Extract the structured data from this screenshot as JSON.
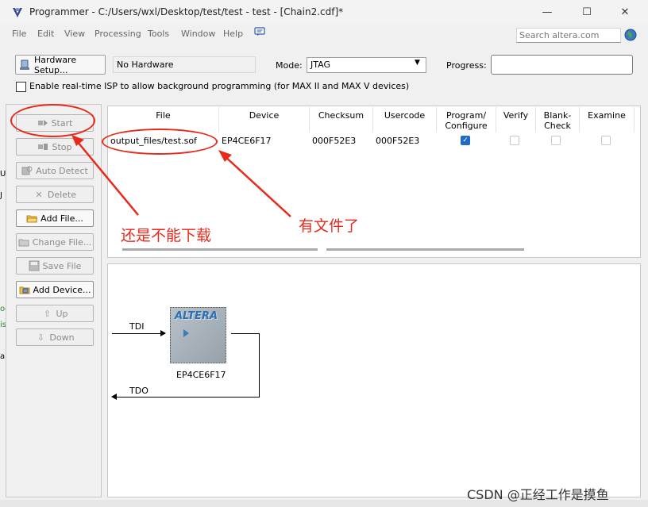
{
  "window": {
    "title": "Programmer - C:/Users/wxl/Desktop/test/test - test - [Chain2.cdf]*",
    "minimize": "—",
    "maximize": "☐",
    "close": "✕"
  },
  "menu": [
    "File",
    "Edit",
    "View",
    "Processing",
    "Tools",
    "Window",
    "Help"
  ],
  "search": {
    "placeholder": "Search altera.com"
  },
  "hardware": {
    "button_label": "Hardware Setup...",
    "current": "No Hardware",
    "mode_label": "Mode:",
    "mode_value": "JTAG",
    "progress_label": "Progress:"
  },
  "isp_option": "Enable real-time ISP to allow background programming (for MAX II and MAX V devices)",
  "actions": {
    "start": "Start",
    "stop": "Stop",
    "auto_detect": "Auto Detect",
    "delete": "Delete",
    "add_file": "Add File...",
    "change_file": "Change File...",
    "save_file": "Save File",
    "add_device": "Add Device...",
    "up": "Up",
    "down": "Down"
  },
  "table": {
    "headers": {
      "file": "File",
      "device": "Device",
      "checksum": "Checksum",
      "usercode": "Usercode",
      "program_1": "Program/",
      "program_2": "Configure",
      "verify": "Verify",
      "blank_1": "Blank-",
      "blank_2": "Check",
      "examine": "Examine"
    },
    "rows": [
      {
        "file": "output_files/test.sof",
        "device": "EP4CE6F17",
        "checksum": "000F52E3",
        "usercode": "000F52E3",
        "program": true,
        "verify": false,
        "blank_check": false,
        "examine": false
      }
    ]
  },
  "diagram": {
    "device": "EP4CE6F17",
    "logo": "ALTERA",
    "tdi": "TDI",
    "tdo": "TDO"
  },
  "annotations": {
    "left": "还是不能下载",
    "right": "有文件了",
    "color": "#e8291c"
  },
  "edge_fragments": [
    "Ur",
    "J",
    "og",
    "is",
    "ar"
  ],
  "watermark": "CSDN @正经工作是摸鱼"
}
